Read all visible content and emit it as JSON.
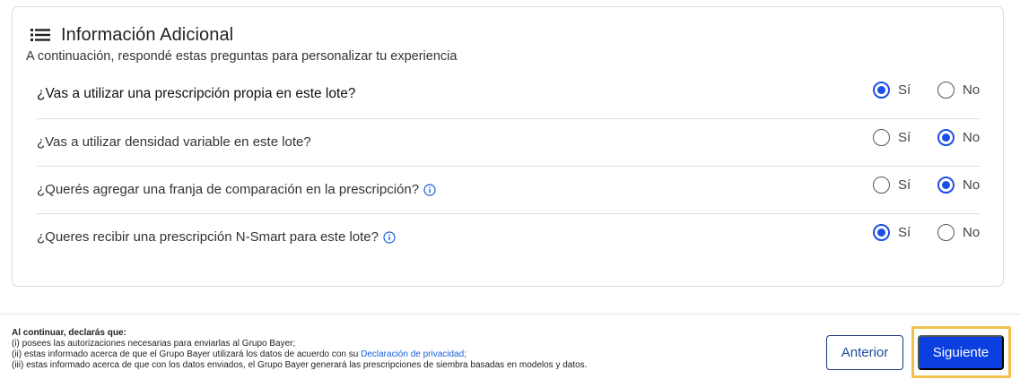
{
  "section": {
    "title": "Información Adicional",
    "subtitle": "A continuación, respondé estas preguntas para personalizar tu experiencia",
    "title_icon": "list-icon"
  },
  "options": {
    "yes": "Sí",
    "no": "No"
  },
  "questions": [
    {
      "text": "¿Vas a utilizar una prescripción propia en este lote?",
      "info_icon": false,
      "selected": "yes"
    },
    {
      "text": "¿Vas a utilizar densidad variable en este lote?",
      "info_icon": false,
      "selected": "no"
    },
    {
      "text": "¿Querés agregar una franja de comparación en la prescripción?",
      "info_icon": true,
      "selected": "no"
    },
    {
      "text": "¿Queres recibir una prescripción N-Smart para este lote?",
      "info_icon": true,
      "selected": "yes"
    }
  ],
  "footer": {
    "lead": "Al continuar, declarás que:",
    "line1": "(i) posees las autorizaciones necesarias para enviarlas al Grupo Bayer;",
    "line2_prefix": "(ii) estas informado acerca de que el Grupo Bayer utilizará los datos de acuerdo con su ",
    "line2_link": "Declaración de privacidad;",
    "line3": "(iii) estas informado acerca de que con los datos enviados, el Grupo Bayer generará las prescripciones de siembra basadas en modelos y datos."
  },
  "buttons": {
    "previous": "Anterior",
    "next": "Siguiente"
  },
  "colors": {
    "accent": "#0b3fe0",
    "radio_checked": "#1a4ee6",
    "link": "#1a5fd6",
    "highlight": "#f0c24d"
  }
}
